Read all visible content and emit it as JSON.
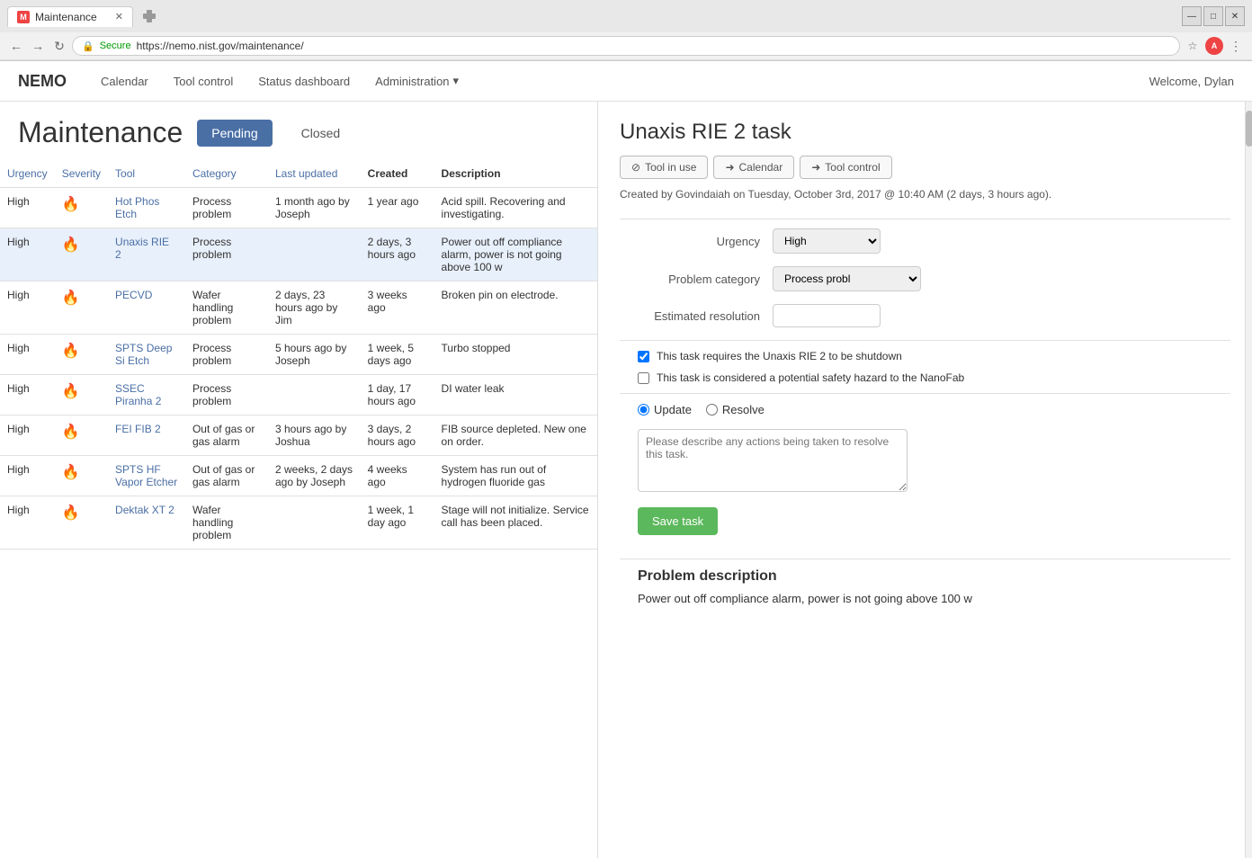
{
  "browser": {
    "tab_title": "Maintenance",
    "url": "https://nemo.nist.gov/maintenance/",
    "url_display": "https://nemo.nist.gov/maintenance/",
    "back_label": "‹",
    "forward_label": "›",
    "refresh_label": "↻",
    "secure_label": "Secure"
  },
  "navbar": {
    "logo": "NEMO",
    "links": [
      {
        "label": "Calendar"
      },
      {
        "label": "Tool control"
      },
      {
        "label": "Status dashboard"
      },
      {
        "label": "Administration"
      }
    ],
    "welcome": "Welcome, Dylan"
  },
  "page": {
    "title": "Maintenance",
    "btn_pending": "Pending",
    "btn_closed": "Closed"
  },
  "table": {
    "columns": [
      {
        "label": "Urgency"
      },
      {
        "label": "Severity"
      },
      {
        "label": "Tool"
      },
      {
        "label": "Category"
      },
      {
        "label": "Last updated"
      },
      {
        "label": "Created"
      },
      {
        "label": "Description"
      }
    ],
    "rows": [
      {
        "urgency": "High",
        "severity": "🔥",
        "tool": "Hot Phos Etch",
        "category": "Process problem",
        "last_updated": "1 month ago by Joseph",
        "created": "1 year ago",
        "description": "Acid spill. Recovering and investigating."
      },
      {
        "urgency": "High",
        "severity": "🔥",
        "tool": "Unaxis RIE 2",
        "category": "Process problem",
        "last_updated": "",
        "created": "2 days, 3 hours ago",
        "description": "Power out off compliance alarm, power is not going above 100 w"
      },
      {
        "urgency": "High",
        "severity": "🔥",
        "tool": "PECVD",
        "category": "Wafer handling problem",
        "last_updated": "2 days, 23 hours ago by Jim",
        "created": "3 weeks ago",
        "description": "Broken pin on electrode."
      },
      {
        "urgency": "High",
        "severity": "🔥",
        "tool": "SPTS Deep Si Etch",
        "category": "Process problem",
        "last_updated": "5 hours ago by Joseph",
        "created": "1 week, 5 days ago",
        "description": "Turbo stopped"
      },
      {
        "urgency": "High",
        "severity": "🔥",
        "tool": "SSEC Piranha 2",
        "category": "Process problem",
        "last_updated": "",
        "created": "1 day, 17 hours ago",
        "description": "DI water leak"
      },
      {
        "urgency": "High",
        "severity": "🔥",
        "tool": "FEI FIB 2",
        "category": "Out of gas or gas alarm",
        "last_updated": "3 hours ago by Joshua",
        "created": "3 days, 2 hours ago",
        "description": "FIB source depleted. New one on order."
      },
      {
        "urgency": "High",
        "severity": "🔥",
        "tool": "SPTS HF Vapor Etcher",
        "category": "Out of gas or gas alarm",
        "last_updated": "2 weeks, 2 days ago by Joseph",
        "created": "4 weeks ago",
        "description": "System has run out of hydrogen fluoride gas"
      },
      {
        "urgency": "High",
        "severity": "🔥",
        "tool": "Dektak XT 2",
        "category": "Wafer handling problem",
        "last_updated": "",
        "created": "1 week, 1 day ago",
        "description": "Stage will not initialize. Service call has been placed."
      }
    ]
  },
  "task_detail": {
    "title": "Unaxis RIE 2 task",
    "btn_tool_in_use": "Tool in use",
    "btn_calendar": "Calendar",
    "btn_tool_control": "Tool control",
    "created_text": "Created by Govindaiah on Tuesday, October 3rd, 2017 @ 10:40 AM (2 days, 3 hours ago).",
    "urgency_label": "Urgency",
    "urgency_value": "High",
    "problem_category_label": "Problem category",
    "problem_category_value": "Process probl",
    "estimated_resolution_label": "Estimated resolution",
    "estimated_resolution_value": "",
    "checkbox1_label": "This task requires the Unaxis RIE 2 to be shutdown",
    "checkbox1_checked": true,
    "checkbox2_label": "This task is considered a potential safety hazard to the NanoFab",
    "checkbox2_checked": false,
    "radio_update": "Update",
    "radio_resolve": "Resolve",
    "textarea_placeholder": "Please describe any actions being taken to resolve this task.",
    "btn_save": "Save task",
    "problem_desc_title": "Problem description",
    "problem_desc_text": "Power out off compliance alarm, power is not going above 100 w"
  }
}
